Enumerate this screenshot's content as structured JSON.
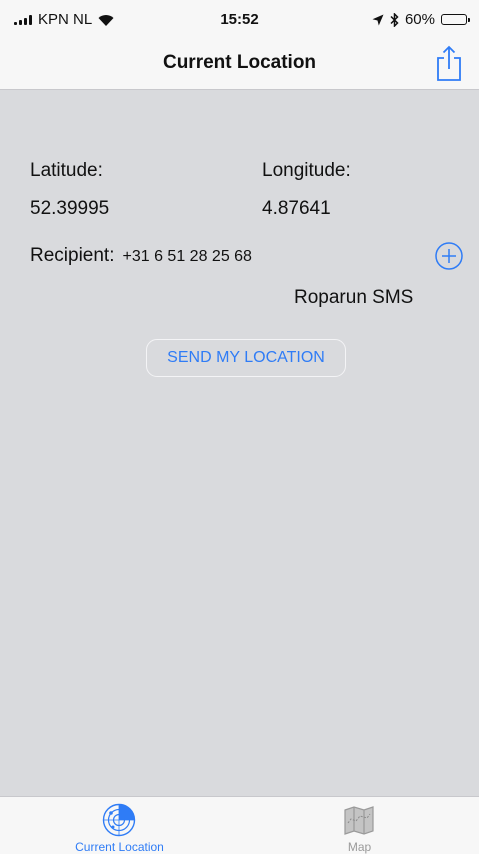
{
  "status_bar": {
    "carrier": "KPN NL",
    "time": "15:52",
    "battery_percent": "60%",
    "battery_level": 0.6
  },
  "nav": {
    "title": "Current Location",
    "share_icon": "share-icon"
  },
  "location": {
    "latitude_label": "Latitude:",
    "latitude_value": "52.39995",
    "longitude_label": "Longitude:",
    "longitude_value": "4.87641"
  },
  "recipient": {
    "label": "Recipient:",
    "number": "+31 6 51 28 25 68",
    "add_icon": "plus-circle-icon",
    "name": "Roparun SMS"
  },
  "actions": {
    "send_label": "SEND MY LOCATION"
  },
  "tabs": [
    {
      "label": "Current Location",
      "icon": "radar-icon",
      "selected": true
    },
    {
      "label": "Map",
      "icon": "map-icon",
      "selected": false
    }
  ],
  "colors": {
    "accent": "#2f7cf6",
    "background": "#d9dadd",
    "bar": "#f7f7f7",
    "inactive_tab": "#9a9a9a"
  }
}
